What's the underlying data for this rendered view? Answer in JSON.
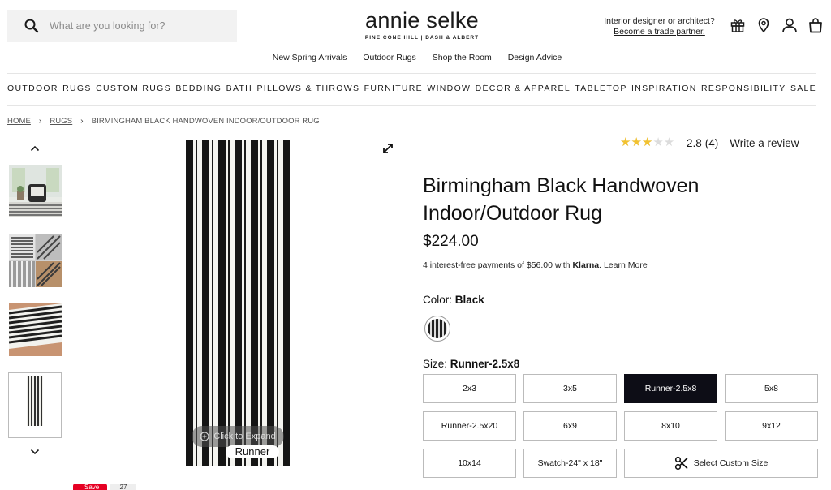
{
  "header": {
    "search_placeholder": "What are you looking for?",
    "logo_main": "annie selke",
    "logo_sub": "PINE CONE HILL  |  DASH & ALBERT",
    "trade_text": "Interior designer or architect?",
    "trade_link": "Become a trade partner.",
    "icons": [
      "gift-icon",
      "location-icon",
      "account-icon",
      "bag-icon"
    ]
  },
  "subnav": [
    "New Spring Arrivals",
    "Outdoor Rugs",
    "Shop the Room",
    "Design Advice"
  ],
  "mainnav": [
    "OUTDOOR",
    "RUGS",
    "CUSTOM RUGS",
    "BEDDING",
    "BATH",
    "PILLOWS & THROWS",
    "FURNITURE",
    "WINDOW",
    "DÉCOR & APPAREL",
    "TABLETOP",
    "INSPIRATION",
    "RESPONSIBILITY",
    "SALE"
  ],
  "breadcrumb": {
    "home": "HOME",
    "rugs": "RUGS",
    "current": "BIRMINGHAM BLACK HANDWOVEN INDOOR/OUTDOOR RUG"
  },
  "gallery": {
    "up": "⌃",
    "down": "⌄",
    "expand_text": "Click to Expand",
    "image_label": "Runner"
  },
  "product": {
    "rating": 2.8,
    "rating_text": "2.8",
    "rating_count": "(4)",
    "review_link": "Write a review",
    "title": "Birmingham Black Handwoven Indoor/Outdoor Rug",
    "price": "$224.00",
    "klarna_prefix": "4 interest-free payments of $56.00 with ",
    "klarna_brand": "Klarna",
    "klarna_suffix": ". ",
    "klarna_link": "Learn More",
    "color_label": "Color:",
    "color_value": "Black",
    "size_label": "Size:",
    "size_value": "Runner-2.5x8",
    "sizes": [
      "2x3",
      "3x5",
      "Runner-2.5x8",
      "5x8",
      "Runner-2.5x20",
      "6x9",
      "8x10",
      "9x12",
      "10x14",
      "Swatch-24\" x 18\""
    ],
    "custom_size": "Select Custom Size"
  },
  "social": {
    "save": "Save",
    "count": "27"
  },
  "colors": {
    "star": "#f2c230",
    "selected_bg": "#0d0d16",
    "pinterest": "#e60023"
  }
}
